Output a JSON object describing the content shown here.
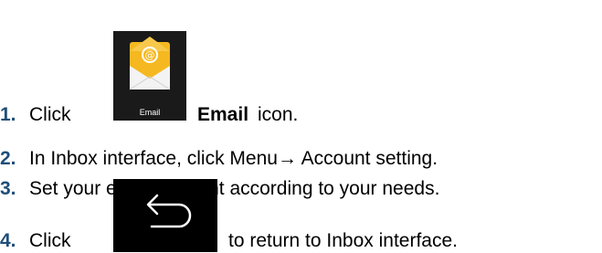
{
  "steps": [
    {
      "number": "1.",
      "prefix": "Click",
      "bold": "Email",
      "suffix": "icon.",
      "icon": "email-app-icon",
      "icon_label": "Email"
    },
    {
      "number": "2.",
      "text": "In Inbox interface, click Menu→ Account setting."
    },
    {
      "number": "3.",
      "text": "Set your email account according to your needs."
    },
    {
      "number": "4.",
      "prefix": "Click",
      "suffix": "to return to Inbox interface.",
      "icon": "back-arrow-icon"
    }
  ],
  "colors": {
    "number": "#1f4e79",
    "text": "#000000",
    "icon_bg": "#1a1a1a",
    "envelope_yellow": "#f5b820"
  }
}
